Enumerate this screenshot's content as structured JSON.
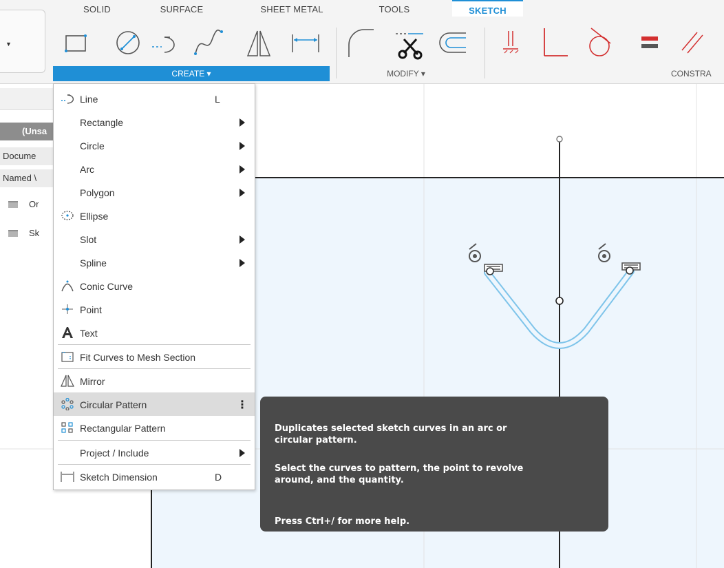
{
  "toolbar": {
    "tabs": [
      {
        "label": "SOLID",
        "active": false
      },
      {
        "label": "SURFACE",
        "active": false
      },
      {
        "label": "SHEET METAL",
        "active": false
      },
      {
        "label": "TOOLS",
        "active": false
      },
      {
        "label": "SKETCH",
        "active": true
      }
    ],
    "groups": {
      "create": "CREATE ▾",
      "modify": "MODIFY ▾",
      "constrain": "CONSTRA"
    }
  },
  "browser": {
    "title": "(Unsa",
    "items": [
      "Docume",
      "Named \\",
      "Or",
      "Sk"
    ]
  },
  "create_menu": {
    "items": [
      {
        "label": "Line",
        "shortcut": "L",
        "icon": "line-icon"
      },
      {
        "label": "Rectangle",
        "submenu": true
      },
      {
        "label": "Circle",
        "submenu": true
      },
      {
        "label": "Arc",
        "submenu": true
      },
      {
        "label": "Polygon",
        "submenu": true
      },
      {
        "label": "Ellipse",
        "icon": "ellipse-icon"
      },
      {
        "label": "Slot",
        "submenu": true
      },
      {
        "label": "Spline",
        "submenu": true
      },
      {
        "label": "Conic Curve",
        "icon": "conic-curve-icon"
      },
      {
        "label": "Point",
        "icon": "point-icon"
      },
      {
        "label": "Text",
        "icon": "text-icon"
      },
      {
        "label": "Fit Curves to Mesh Section",
        "icon": "fit-curves-icon"
      },
      {
        "label": "Mirror",
        "icon": "mirror-icon"
      },
      {
        "label": "Circular Pattern",
        "icon": "circular-pattern-icon",
        "highlighted": true
      },
      {
        "label": "Rectangular Pattern",
        "icon": "rectangular-pattern-icon"
      },
      {
        "label": "Project / Include",
        "submenu": true
      },
      {
        "label": "Sketch Dimension",
        "shortcut": "D",
        "icon": "sketch-dimension-icon"
      }
    ]
  },
  "tooltip": {
    "line1": "Duplicates selected sketch curves in an arc or",
    "line2": "circular pattern.",
    "line3": "Select the curves to pattern, the point to revolve",
    "line4": "around, and the quantity.",
    "line5": "Press Ctrl+/ for more help."
  },
  "colors": {
    "accent": "#1f8fd6",
    "sketch_curve": "#7ec4ea",
    "sketch_plane": "#eef6fd",
    "constraint_red": "#d32f2f",
    "tooltip_bg": "#4a4a4a"
  }
}
